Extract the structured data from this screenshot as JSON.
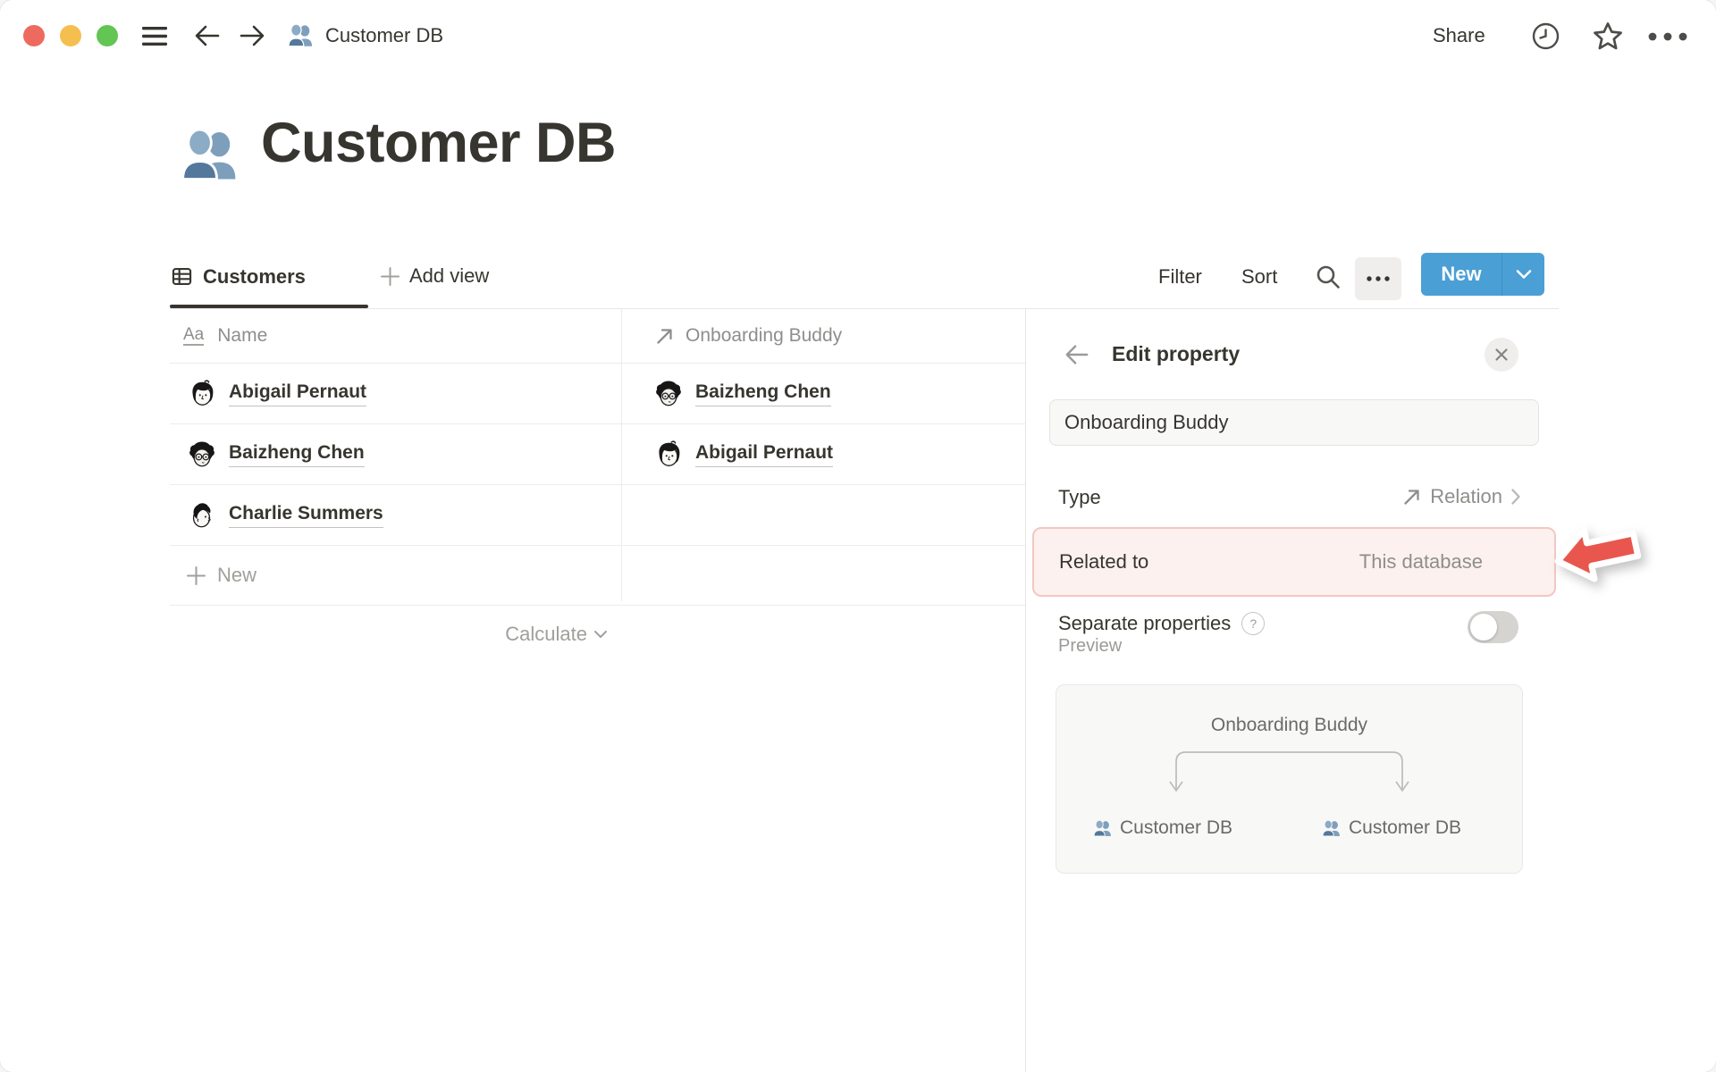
{
  "window": {
    "controls": [
      "close",
      "minimize",
      "zoom"
    ],
    "nav": {
      "title": "Customer DB"
    },
    "actions": {
      "share_label": "Share"
    }
  },
  "page": {
    "title": "Customer DB"
  },
  "view_bar": {
    "tabs": [
      {
        "label": "Customers",
        "active": true
      }
    ],
    "add_view_label": "Add view",
    "filter_label": "Filter",
    "sort_label": "Sort",
    "new_button_label": "New"
  },
  "table": {
    "columns": [
      {
        "label": "Name",
        "type": "title",
        "icon": "text-property-icon"
      },
      {
        "label": "Onboarding Buddy",
        "type": "relation",
        "icon": "relation-icon"
      }
    ],
    "rows": [
      {
        "name": "Abigail Pernaut",
        "buddy": "Baizheng Chen"
      },
      {
        "name": "Baizheng Chen",
        "buddy": "Abigail Pernaut"
      },
      {
        "name": "Charlie Summers",
        "buddy": ""
      }
    ],
    "new_row_label": "New",
    "calculate_label": "Calculate"
  },
  "panel": {
    "title": "Edit property",
    "name_input": {
      "value": "Onboarding Buddy"
    },
    "type_row": {
      "label": "Type",
      "value": "Relation"
    },
    "related_row": {
      "label": "Related to",
      "value": "This database"
    },
    "separate_row": {
      "label": "Separate properties",
      "state": "off"
    },
    "preview": {
      "label": "Preview",
      "relation_name": "Onboarding Buddy",
      "left_database": "Customer DB",
      "right_database": "Customer DB"
    }
  },
  "colors": {
    "accent_blue": "#4a9fd5",
    "highlight_bg": "#fcf1ef",
    "highlight_border": "#f3c7c2",
    "annotation_red": "#e8564d",
    "db_icon_blue": "#587fa2"
  }
}
